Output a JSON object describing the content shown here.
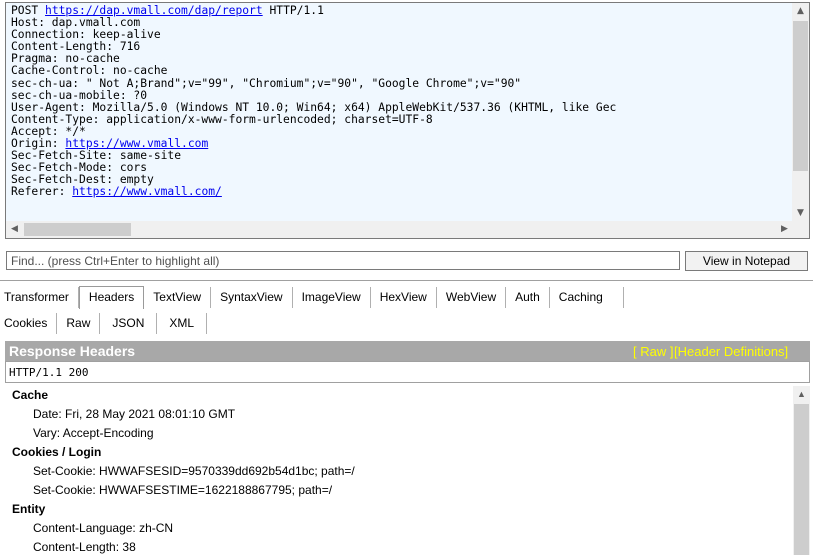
{
  "request": {
    "line_parts": [
      "POST ",
      "https://dap.vmall.com/dap/report",
      " HTTP/1.1"
    ],
    "headers": [
      "Host: dap.vmall.com",
      "Connection: keep-alive",
      "Content-Length: 716",
      "Pragma: no-cache",
      "Cache-Control: no-cache",
      "sec-ch-ua: \" Not A;Brand\";v=\"99\", \"Chromium\";v=\"90\", \"Google Chrome\";v=\"90\"",
      "sec-ch-ua-mobile: ?0",
      "User-Agent: Mozilla/5.0 (Windows NT 10.0; Win64; x64) AppleWebKit/537.36 (KHTML, like Gec",
      "Content-Type: application/x-www-form-urlencoded; charset=UTF-8",
      "Accept: */*"
    ],
    "origin_label": "Origin: ",
    "origin_url": "https://www.vmall.com",
    "headers2": [
      "Sec-Fetch-Site: same-site",
      "Sec-Fetch-Mode: cors",
      "Sec-Fetch-Dest: empty"
    ],
    "referer_label": "Referer: ",
    "referer_url": "https://www.vmall.com/"
  },
  "find": {
    "placeholder": "Find... (press Ctrl+Enter to highlight all)",
    "notepad_button": "View in Notepad"
  },
  "tabs_row1": [
    "Transformer",
    "Headers",
    "TextView",
    "SyntaxView",
    "ImageView",
    "HexView",
    "WebView",
    "Auth",
    "Caching"
  ],
  "tabs_row2": [
    "Cookies",
    "Raw",
    "JSON",
    "XML"
  ],
  "active_tab": "Headers",
  "response": {
    "title": "Response Headers",
    "raw_link": "[ Raw ]",
    "definitions_link": "[Header Definitions]",
    "status_line": "HTTP/1.1 200",
    "groups": [
      {
        "name": "Cache",
        "headers": [
          "Date: Fri, 28 May 2021 08:01:10 GMT",
          "Vary: Accept-Encoding"
        ]
      },
      {
        "name": "Cookies / Login",
        "headers": [
          "Set-Cookie: HWWAFSESID=9570339dd692b54d1bc; path=/",
          "Set-Cookie: HWWAFSESTIME=1622188867795; path=/"
        ]
      },
      {
        "name": "Entity",
        "headers": [
          "Content-Language: zh-CN",
          "Content-Length: 38"
        ]
      }
    ]
  },
  "colors": {
    "link": "#0000ee",
    "request_bg": "#f0f8ff",
    "title_bar": "#a8a8a8",
    "title_links": "#ffff00"
  }
}
